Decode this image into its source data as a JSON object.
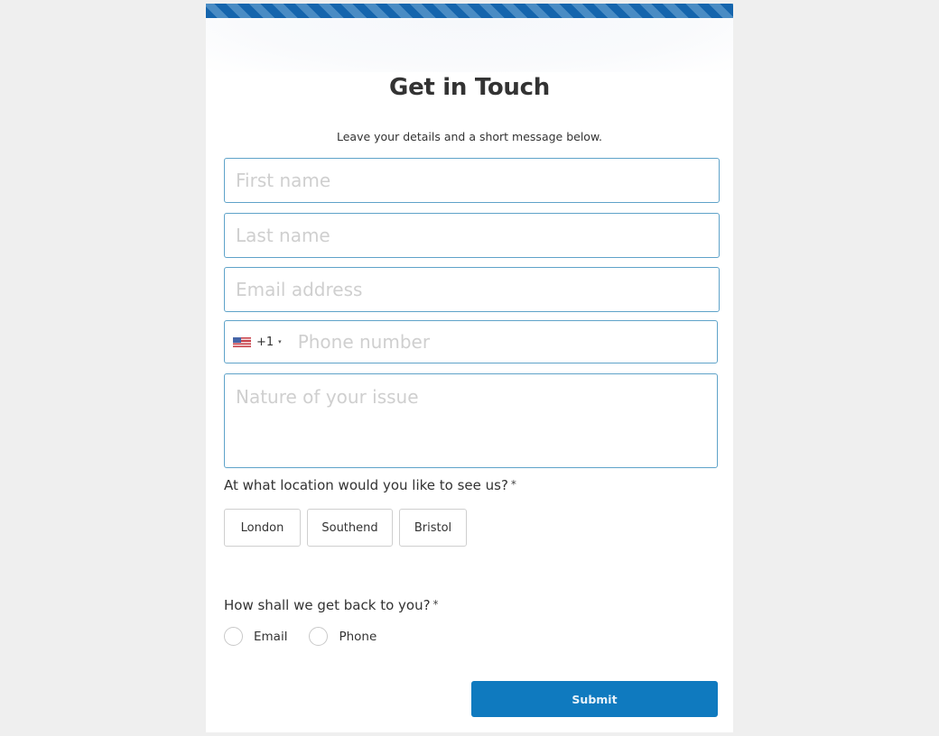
{
  "header": {
    "title": "Get in Touch",
    "subtitle": "Leave your details and a short message below."
  },
  "form": {
    "first_name": {
      "placeholder": "First name",
      "value": ""
    },
    "last_name": {
      "placeholder": "Last name",
      "value": ""
    },
    "email": {
      "placeholder": "Email address",
      "value": ""
    },
    "phone": {
      "country_flag": "us-flag-icon",
      "dial_code": "+1",
      "caret": "▾",
      "placeholder": "Phone number",
      "value": ""
    },
    "issue": {
      "placeholder": "Nature of your issue",
      "value": ""
    },
    "location_question": {
      "label": "At what location would you like to see us?",
      "required_mark": "*",
      "options": [
        "London",
        "Southend",
        "Bristol"
      ],
      "selected": null
    },
    "contact_question": {
      "label": "How shall we get back to you?",
      "required_mark": "*",
      "options": [
        "Email",
        "Phone"
      ],
      "selected": null
    },
    "submit_label": "Submit"
  },
  "colors": {
    "stripe_dark": "#1565ad",
    "stripe_light": "#4a8cc4",
    "input_border": "#5fa3c9",
    "submit_bg": "#0f7abf",
    "page_bg": "#efefef"
  }
}
